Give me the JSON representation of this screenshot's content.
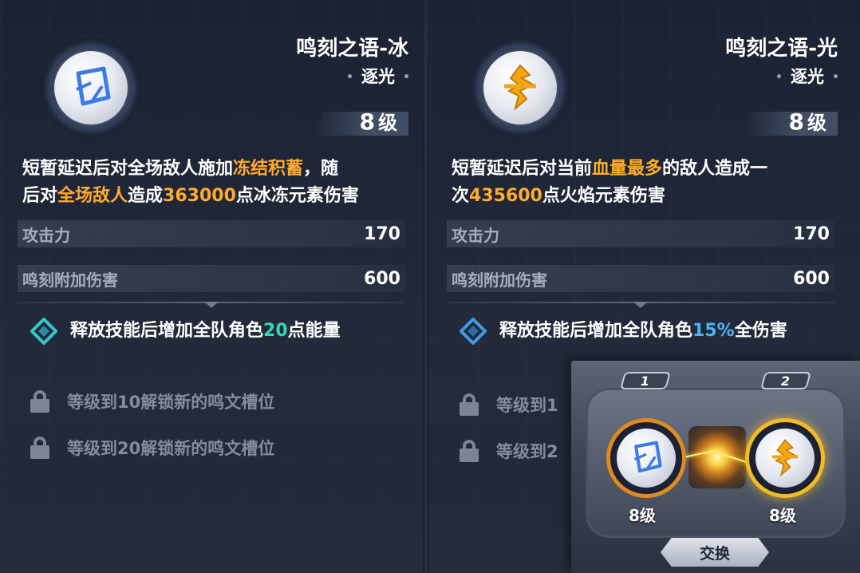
{
  "left_panel": {
    "title": "鸣刻之语-冰",
    "subtitle": "逐光",
    "level": "8",
    "level_unit": "级",
    "desc_line1_a": "短暂延迟后对全场敌人施加",
    "desc_line1_hl": "冻结积蓄",
    "desc_line1_b": "，随",
    "desc_line2_a": "后对",
    "desc_line2_hl1": "全场敌人",
    "desc_line2_b": "造成",
    "desc_line2_hl2": "363000",
    "desc_line2_c": "点冰冻元素伤害",
    "stats": [
      {
        "label": "攻击力",
        "value": "170"
      },
      {
        "label": "鸣刻附加伤害",
        "value": "600"
      }
    ],
    "bonus_a": "释放技能后增加全队角色",
    "bonus_hl": "20",
    "bonus_b": "点能量",
    "locks": [
      "等级到10解锁新的鸣文槽位",
      "等级到20解锁新的鸣文槽位"
    ],
    "icon": "ice-rune-icon"
  },
  "right_panel": {
    "title": "鸣刻之语-光",
    "subtitle": "逐光",
    "level": "8",
    "level_unit": "级",
    "desc_line1_a": "短暂延迟后对当前",
    "desc_line1_hl": "血量最多",
    "desc_line1_b": "的敌人造成一",
    "desc_line2_a": "次",
    "desc_line2_hl": "435600",
    "desc_line2_b": "点火焰元素伤害",
    "stats": [
      {
        "label": "攻击力",
        "value": "170"
      },
      {
        "label": "鸣刻附加伤害",
        "value": "600"
      }
    ],
    "bonus_a": "释放技能后增加全队角色",
    "bonus_hl": "15%",
    "bonus_b": "全伤害",
    "locks": [
      "等级到1",
      "等级到2"
    ],
    "icon": "light-rune-icon"
  },
  "swap_popup": {
    "slot1_num": "1",
    "slot2_num": "2",
    "slot1_level": "8级",
    "slot2_level": "8级",
    "button_label": "交换"
  },
  "colors": {
    "highlight_orange": "#ffab2e",
    "highlight_blue": "#4fb4ee",
    "highlight_green": "#39d6b4"
  }
}
